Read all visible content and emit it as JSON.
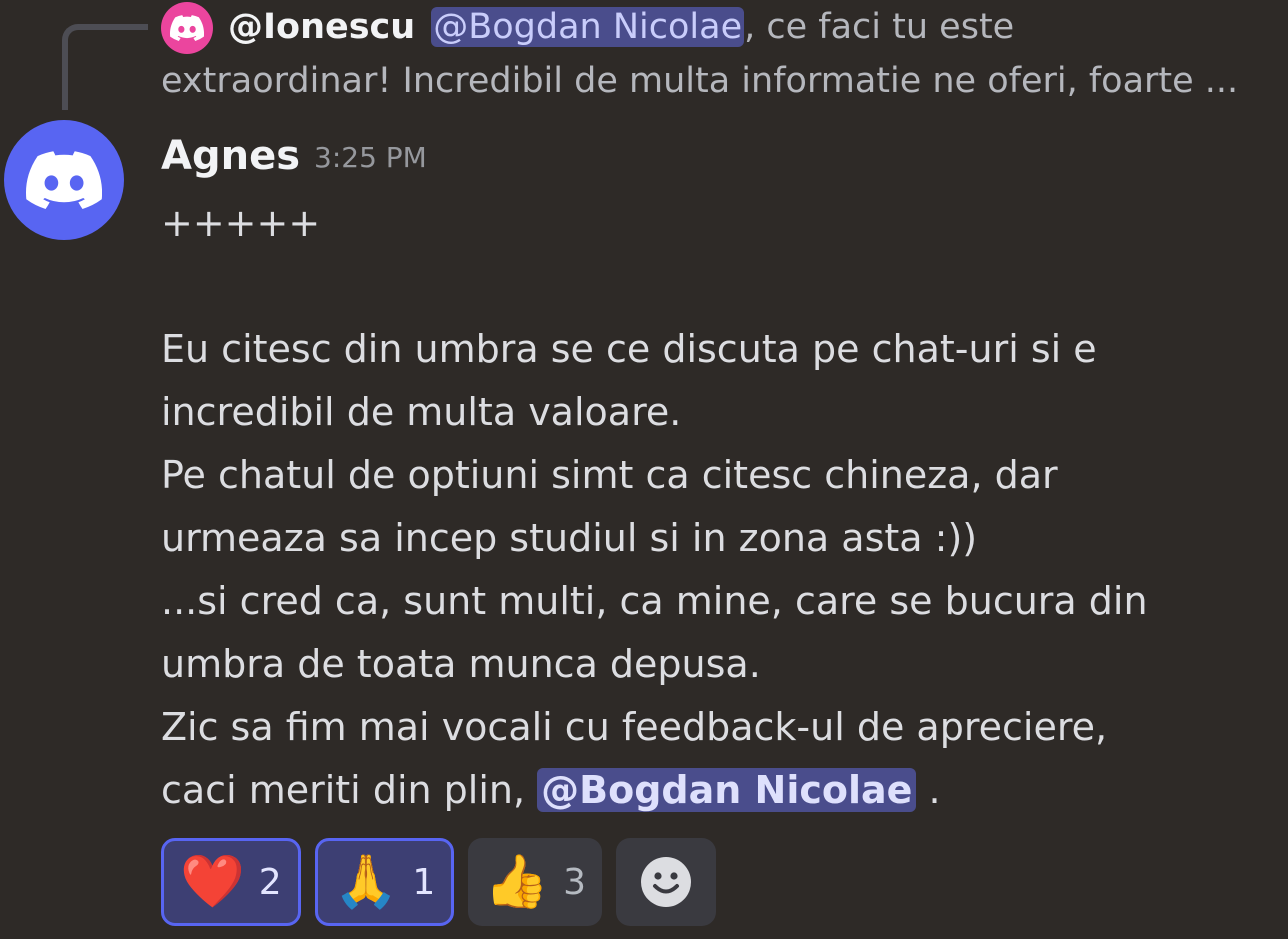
{
  "reply": {
    "author": "@Ionescu",
    "mention": "@Bogdan Nicolae",
    "text_part1": ", ce faci tu este",
    "text_part2": "extraordinar! Incredibil de multa informatie ne oferi, foarte ..."
  },
  "message": {
    "author": "Agnes",
    "timestamp": "3:25 PM",
    "lines": [
      "+++++",
      "",
      "Eu citesc din umbra se ce discuta pe chat-uri si e",
      "incredibil de multa valoare.",
      "Pe chatul de optiuni simt ca citesc chineza, dar",
      "urmeaza sa incep studiul si in zona asta :))",
      "...si cred ca, sunt multi, ca mine, care se bucura din",
      "umbra de toata munca depusa.",
      "Zic sa fim mai vocali cu feedback-ul de apreciere,"
    ],
    "last_line_prefix": "caci meriti din plin, ",
    "last_line_mention": "@Bogdan Nicolae",
    "last_line_suffix": " ."
  },
  "reactions": [
    {
      "emoji": "❤️",
      "count": "2",
      "active": true
    },
    {
      "emoji": "🙏",
      "count": "1",
      "active": true
    },
    {
      "emoji": "👍",
      "count": "3",
      "active": false
    }
  ],
  "add_reaction_icon": "smiley-icon",
  "colors": {
    "background": "#2e2a27",
    "blurple": "#5865f2",
    "mention_bg": "#4a4d8c",
    "reply_avatar": "#eb459e"
  }
}
